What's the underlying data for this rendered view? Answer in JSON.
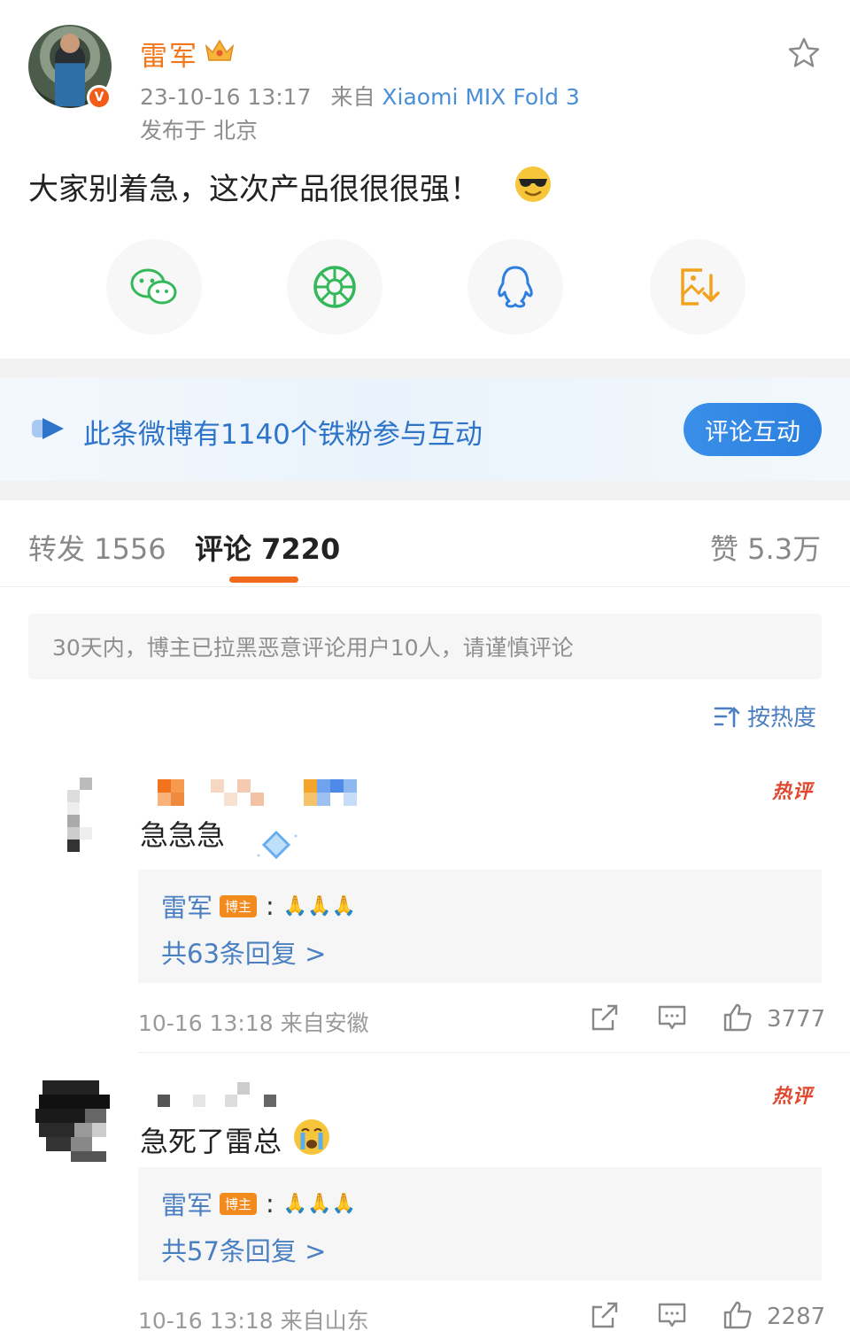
{
  "post": {
    "author": "雷军",
    "timestamp": "23-10-16 13:17",
    "source_prefix": "来自",
    "device": "Xiaomi MIX Fold 3",
    "location": "发布于 北京",
    "text": "大家别着急，这次产品很很很强！"
  },
  "share": {
    "items": [
      "wechat-icon",
      "moments-icon",
      "qq-icon",
      "save-image-icon"
    ]
  },
  "banner": {
    "text": "此条微博有1140个铁粉参与互动",
    "button": "评论互动"
  },
  "tabs": {
    "repost": "转发 1556",
    "comment": "评论 7220",
    "like": "赞 5.3万"
  },
  "notice": "30天内，博主已拉黑恶意评论用户10人，请谨慎评论",
  "sort_label": "按热度",
  "comments": [
    {
      "hot": "热评",
      "text": "急急急",
      "reply_author": "雷军",
      "reply_tag": "博主",
      "reply_count": "共63条回复 >",
      "time": "10-16 13:18 来自安徽",
      "likes": "3777"
    },
    {
      "hot": "热评",
      "text": "急死了雷总",
      "reply_author": "雷军",
      "reply_tag": "博主",
      "reply_count": "共57条回复 >",
      "time": "10-16 13:18 来自山东",
      "likes": "2287"
    }
  ],
  "colors": {
    "brand_orange": "#f2771c",
    "link_blue": "#4a7fc1",
    "hot_red": "#e0492f"
  }
}
